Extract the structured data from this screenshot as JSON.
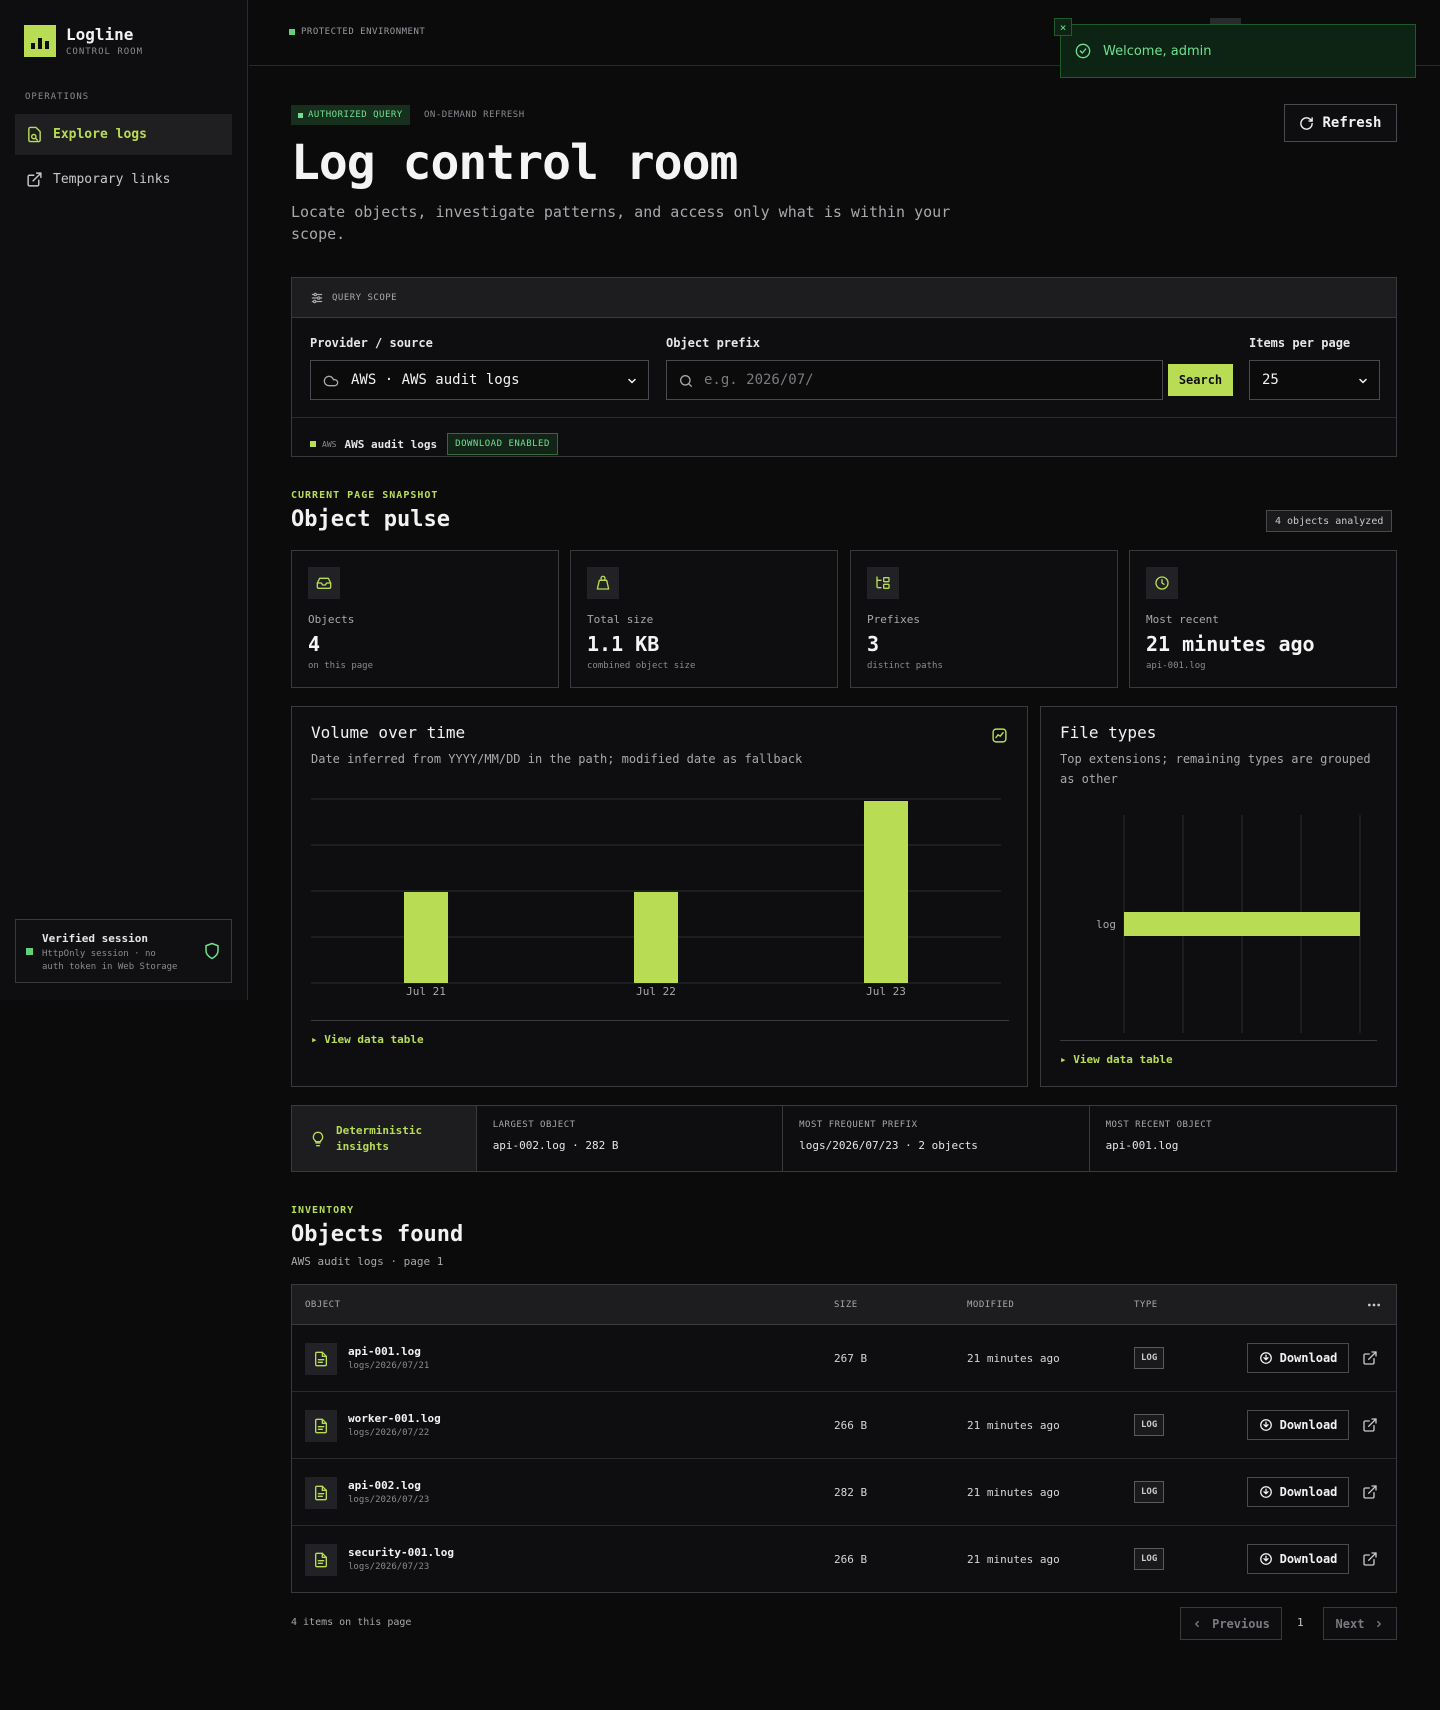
{
  "brand": {
    "name": "Logline",
    "subtitle": "CONTROL ROOM"
  },
  "sidebar": {
    "section_label": "OPERATIONS",
    "items": [
      {
        "label": "Explore logs",
        "icon": "explore-icon",
        "active": true
      },
      {
        "label": "Temporary links",
        "icon": "external-link-icon",
        "active": false
      }
    ],
    "session": {
      "title": "Verified session",
      "subtitle": "HttpOnly session · no auth token in Web Storage"
    }
  },
  "topbar": {
    "environment": "PROTECTED ENVIRONMENT"
  },
  "toast": {
    "message": "Welcome, admin",
    "close": "×"
  },
  "header": {
    "badge": "AUTHORIZED QUERY",
    "badge_secondary": "ON-DEMAND REFRESH",
    "title": "Log control room",
    "description": "Locate objects, investigate patterns, and access only what is within your scope.",
    "refresh_label": "Refresh"
  },
  "scope": {
    "heading": "QUERY SCOPE",
    "provider_label": "Provider / source",
    "provider_value": "AWS · AWS audit logs",
    "prefix_label": "Object prefix",
    "prefix_placeholder": "e.g. 2026/07/",
    "search_label": "Search",
    "per_page_label": "Items per page",
    "per_page_value": "25",
    "source_provider": "AWS",
    "source_name": "AWS audit logs",
    "download_badge": "DOWNLOAD ENABLED"
  },
  "pulse": {
    "eyebrow": "CURRENT PAGE SNAPSHOT",
    "title": "Object pulse",
    "count_chip": "4 objects analyzed",
    "stats": [
      {
        "label": "Objects",
        "value": "4",
        "sub": "on this page",
        "icon": "inbox-icon"
      },
      {
        "label": "Total size",
        "value": "1.1 KB",
        "sub": "combined object size",
        "icon": "weight-icon"
      },
      {
        "label": "Prefixes",
        "value": "3",
        "sub": "distinct paths",
        "icon": "folder-tree-icon"
      },
      {
        "label": "Most recent",
        "value": "21 minutes ago",
        "sub": "api-001.log",
        "icon": "clock-icon"
      }
    ]
  },
  "volume_chart": {
    "title": "Volume over time",
    "subtitle": "Date inferred from YYYY/MM/DD in the path; modified date as fallback",
    "view_table": "▸ View data table",
    "bar_color": "#b8dd55"
  },
  "types_chart": {
    "title": "File types",
    "subtitle": "Top extensions; remaining types are grouped as other",
    "view_table": "▸ View data table",
    "bar_color": "#b8dd55"
  },
  "chart_data": [
    {
      "type": "bar",
      "categories": [
        "Jul 21",
        "Jul 22",
        "Jul 23"
      ],
      "values": [
        1,
        1,
        2
      ],
      "ylim": [
        0,
        2
      ],
      "grid": true
    },
    {
      "type": "bar",
      "orientation": "horizontal",
      "categories": [
        "log"
      ],
      "values": [
        4
      ],
      "xlim": [
        0,
        4
      ],
      "grid": true
    }
  ],
  "insights": {
    "heading": "Deterministic insights",
    "items": [
      {
        "key": "LARGEST OBJECT",
        "value": "api-002.log · 282 B"
      },
      {
        "key": "MOST FREQUENT PREFIX",
        "value": "logs/2026/07/23 · 2 objects"
      },
      {
        "key": "MOST RECENT OBJECT",
        "value": "api-001.log"
      }
    ]
  },
  "inventory": {
    "eyebrow": "INVENTORY",
    "title": "Objects found",
    "subtitle": "AWS audit logs · page 1",
    "columns": [
      "OBJECT",
      "SIZE",
      "MODIFIED",
      "TYPE"
    ],
    "rows": [
      {
        "name": "api-001.log",
        "path": "logs/2026/07/21",
        "size": "267 B",
        "modified": "21 minutes ago",
        "type": "LOG"
      },
      {
        "name": "worker-001.log",
        "path": "logs/2026/07/22",
        "size": "266 B",
        "modified": "21 minutes ago",
        "type": "LOG"
      },
      {
        "name": "api-002.log",
        "path": "logs/2026/07/23",
        "size": "282 B",
        "modified": "21 minutes ago",
        "type": "LOG"
      },
      {
        "name": "security-001.log",
        "path": "logs/2026/07/23",
        "size": "266 B",
        "modified": "21 minutes ago",
        "type": "LOG"
      }
    ],
    "download_label": "Download"
  },
  "pagination": {
    "info": "4 items on this page",
    "previous": "Previous",
    "page": "1",
    "next": "Next"
  },
  "colors": {
    "accent": "#b8dd55",
    "success": "#6fe08f",
    "background": "#0b0b0c",
    "panel": "#0e0e10"
  }
}
